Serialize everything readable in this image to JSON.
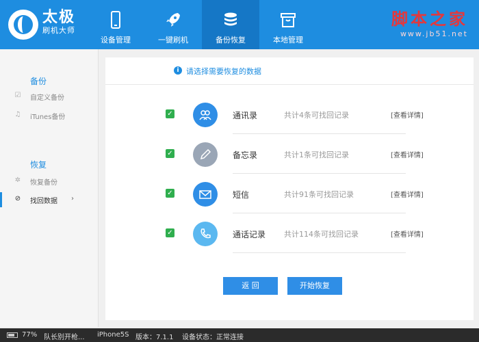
{
  "header": {
    "brand_title": "太极",
    "brand_sub": "刷机大师",
    "nav": [
      {
        "label": "设备管理",
        "icon": "phone-icon"
      },
      {
        "label": "一键刷机",
        "icon": "rocket-icon"
      },
      {
        "label": "备份恢复",
        "icon": "database-icon",
        "active": true
      },
      {
        "label": "本地管理",
        "icon": "box-icon"
      }
    ],
    "watermark_cn": "脚本之家",
    "watermark_url": "www.jb51.net"
  },
  "sidebar": {
    "backup_title": "备份",
    "backup_items": [
      "自定义备份",
      "iTunes备份"
    ],
    "restore_title": "恢复",
    "restore_items": [
      "恢复备份",
      "找回数据"
    ],
    "active_item": "找回数据"
  },
  "main": {
    "info_text": "请选择需要恢复的数据",
    "rows": [
      {
        "label": "通讯录",
        "count": "共计4条可找回记录",
        "link": "[查看详情]",
        "icon": "contacts-icon",
        "color": "#2f8ee6",
        "checked": true
      },
      {
        "label": "备忘录",
        "count": "共计1条可找回记录",
        "link": "[查看详情]",
        "icon": "pen-icon",
        "color": "#9aa6b6",
        "checked": true
      },
      {
        "label": "短信",
        "count": "共计91条可找回记录",
        "link": "[查看详情]",
        "icon": "mail-icon",
        "color": "#2f8ee6",
        "checked": true
      },
      {
        "label": "通话记录",
        "count": "共计114条可找回记录",
        "link": "[查看详情]",
        "icon": "call-icon",
        "color": "#5bb8f0",
        "checked": true
      }
    ],
    "back_button": "返 回",
    "start_button": "开始恢复"
  },
  "status": {
    "battery": "77%",
    "battery_level": 0.77,
    "task": "队长别开枪...",
    "device": "iPhone5S",
    "version": "版本：7.1.1",
    "state": "设备状态：正常连接"
  },
  "colors": {
    "header": "#1e8de0",
    "accent": "#2f8ee6",
    "check": "#2fae4e",
    "watermark": "#e4383c"
  }
}
